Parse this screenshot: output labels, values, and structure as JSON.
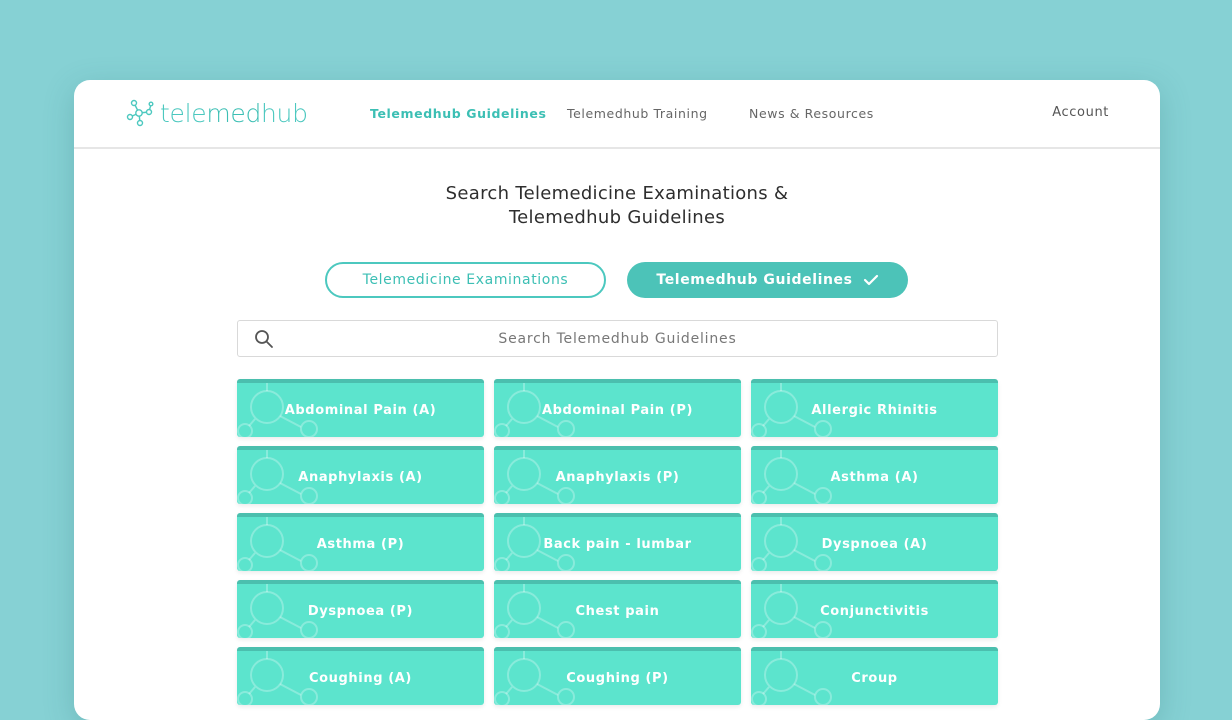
{
  "brand": {
    "name": "telemedhub",
    "part1": "tele",
    "part2": "med",
    "part3": "hub"
  },
  "nav": [
    {
      "label": "Telemedhub Guidelines",
      "active": true
    },
    {
      "label": "Telemedhub Training",
      "active": false
    },
    {
      "label": "News & Resources",
      "active": false
    }
  ],
  "account_label": "Account",
  "heading": {
    "line1": "Search Telemedicine Examinations &",
    "line2": "Telemedhub Guidelines"
  },
  "toggles": {
    "exams_label": "Telemedicine Examinations",
    "guidelines_label": "Telemedhub Guidelines",
    "selected": "guidelines"
  },
  "search": {
    "placeholder": "Search Telemedhub Guidelines",
    "value": ""
  },
  "guidelines": [
    "Abdominal Pain (A)",
    "Abdominal Pain (P)",
    "Allergic Rhinitis",
    "Anaphylaxis (A)",
    "Anaphylaxis (P)",
    "Asthma (A)",
    "Asthma (P)",
    "Back pain - lumbar",
    "Dyspnoea (A)",
    "Dyspnoea (P)",
    "Chest pain",
    "Conjunctivitis",
    "Coughing (A)",
    "Coughing (P)",
    "Croup"
  ],
  "colors": {
    "background": "#86d1d4",
    "accent": "#4cc8bf",
    "card": "#5ce4cd",
    "card_border": "#4bbfae",
    "toggle_active": "#4cc3b8"
  },
  "icons": {
    "logo": "molecule-icon",
    "search": "search-icon",
    "selected": "checkmark-icon"
  }
}
